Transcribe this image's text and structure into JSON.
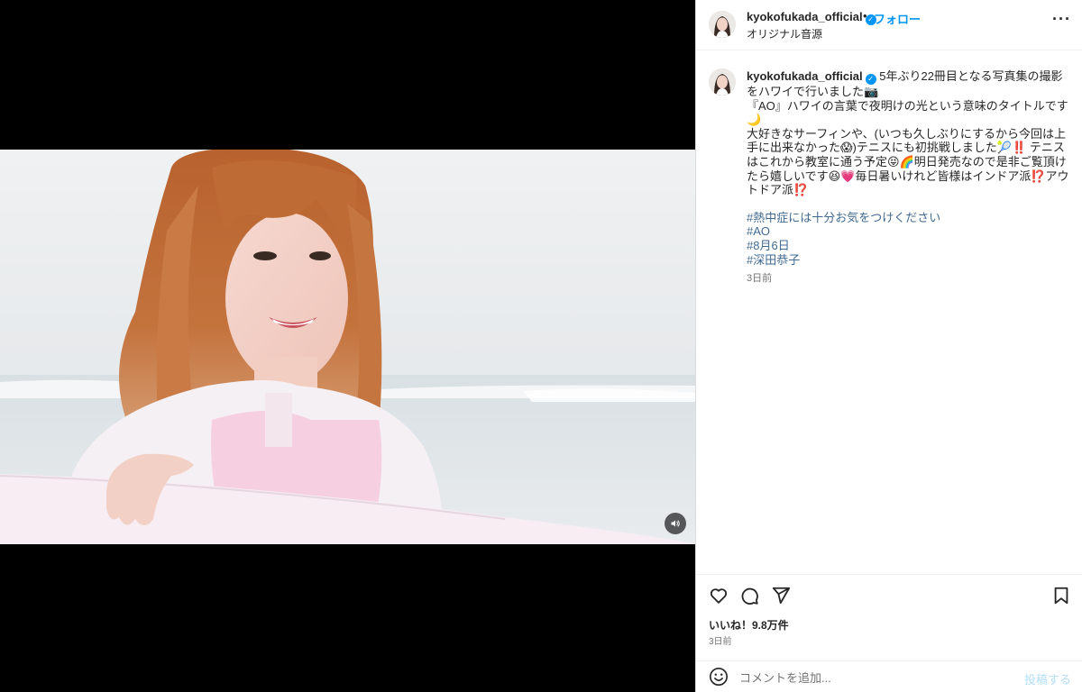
{
  "header": {
    "username": "kyokofukada_official",
    "separator": "•",
    "follow_label": "フォロー",
    "audio_label": "オリジナル音源",
    "more_label": "···"
  },
  "caption": {
    "username": "kyokofukada_official",
    "lines": [
      "5年ぶり22冊目となる写真集の撮影をハワイで行いました📷",
      "『AO』ハワイの言葉で夜明けの光という意味のタイトルです🌙",
      "大好きなサーフィンや、(いつも久しぶりにするから今回は上手に出来なかった😱)テニスにも初挑戦しました🎾‼️ テニスはこれから教室に通う予定😝🌈明日発売なので是非ご覧頂けたら嬉しいです😆💗毎日暑いけれど皆様はインドア派⁉️アウトドア派⁉️"
    ],
    "hashtags": [
      "#熱中症には十分お気をつけください",
      "#AO",
      "#8月6日",
      "#深田恭子"
    ],
    "time": "3日前"
  },
  "actions": {
    "like_icon": "heart-icon",
    "comment_icon": "comment-icon",
    "share_icon": "share-icon",
    "save_icon": "bookmark-icon",
    "likes_text": "いいね！9.8万件",
    "date_text": "3日前"
  },
  "comment": {
    "placeholder": "コメントを追加...",
    "post_label": "投稿する"
  },
  "media": {
    "sound_icon": "speaker-icon"
  },
  "colors": {
    "accent": "#0095f6",
    "hashtag": "#00376b",
    "post_disabled": "#b2dffc"
  }
}
